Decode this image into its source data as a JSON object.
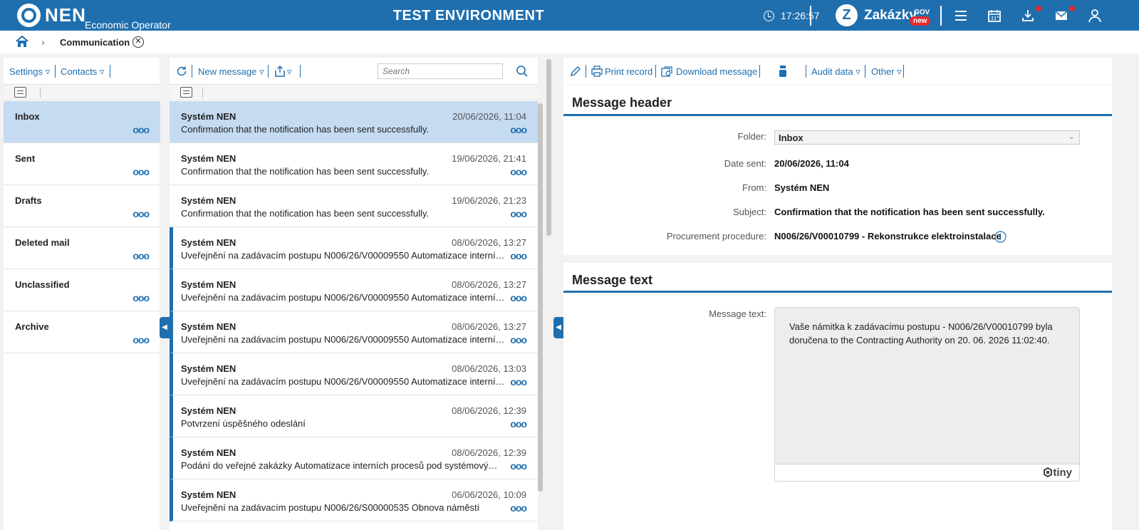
{
  "header": {
    "brand": "NEN",
    "brand_sub": "Economic Operator",
    "environment": "TEST ENVIRONMENT",
    "clock": "17:26:57",
    "zakazky": "Zakázky",
    "zakazky_gov": "GOV",
    "zakazky_badge": "new",
    "icons": [
      "menu-icon",
      "calendar-icon",
      "download-icon",
      "mail-icon",
      "user-icon"
    ]
  },
  "breadcrumb": {
    "current": "Communication"
  },
  "folders_panel": {
    "toolbar": {
      "settings": "Settings ▿",
      "contacts": "Contacts ▿"
    },
    "folders": [
      {
        "label": "Inbox",
        "active": true
      },
      {
        "label": "Sent"
      },
      {
        "label": "Drafts"
      },
      {
        "label": "Deleted mail"
      },
      {
        "label": "Unclassified"
      },
      {
        "label": "Archive"
      }
    ],
    "more": "ooo"
  },
  "messages_panel": {
    "toolbar": {
      "new_message": "New message ▿",
      "export_arrow": "▿",
      "search_placeholder": "Search"
    },
    "messages": [
      {
        "from": "Systém NEN",
        "date": "20/06/2026, 11:04",
        "subject": "Confirmation that the notification has been sent successfully."
      },
      {
        "from": "Systém NEN",
        "date": "19/06/2026, 21:41",
        "subject": "Confirmation that the notification has been sent successfully."
      },
      {
        "from": "Systém NEN",
        "date": "19/06/2026, 21:23",
        "subject": "Confirmation that the notification has been sent successfully."
      },
      {
        "from": "Systém NEN",
        "date": "08/06/2026, 13:27",
        "subject": "Uveřejnění na zadávacím postupu N006/26/V00009550 Automatizace interních procesů"
      },
      {
        "from": "Systém NEN",
        "date": "08/06/2026, 13:27",
        "subject": "Uveřejnění na zadávacím postupu N006/26/V00009550 Automatizace interních procesů"
      },
      {
        "from": "Systém NEN",
        "date": "08/06/2026, 13:27",
        "subject": "Uveřejnění na zadávacím postupu N006/26/V00009550 Automatizace interních procesů"
      },
      {
        "from": "Systém NEN",
        "date": "08/06/2026, 13:03",
        "subject": "Uveřejnění na zadávacím postupu N006/26/V00009550 Automatizace interních procesů"
      },
      {
        "from": "Systém NEN",
        "date": "08/06/2026, 12:39",
        "subject": "Potvrzení úspěšného odeslání"
      },
      {
        "from": "Systém NEN",
        "date": "08/06/2026, 12:39",
        "subject": "Podání do veřejné zakázky Automatizace interních procesů pod systémovým číslem"
      },
      {
        "from": "Systém NEN",
        "date": "06/06/2026, 10:09",
        "subject": "Uveřejnění na zadávacím postupu N006/26/S00000535 Obnova náměstí"
      }
    ]
  },
  "detail_panel": {
    "toolbar": {
      "print": "Print record",
      "download": "Download message",
      "audit": "Audit data ▿",
      "other": "Other ▿"
    },
    "header_section": {
      "title": "Message header",
      "folder_label": "Folder:",
      "folder_value": "Inbox",
      "date_label": "Date sent:",
      "date_value": "20/06/2026, 11:04",
      "from_label": "From:",
      "from_value": "Systém NEN",
      "subject_label": "Subject:",
      "subject_value": "Confirmation that the notification has been sent successfully.",
      "procurement_label": "Procurement procedure:",
      "procurement_value": "N006/26/V00010799 - Rekonstrukce elektroinstalace"
    },
    "text_section": {
      "title": "Message text",
      "label": "Message text:",
      "body": "Vaše námitka k zadávacímu postupu - N006/26/V00010799 byla doručena to the Contracting Authority on 20. 06. 2026 11:02:40.",
      "editor_brand": "tiny"
    }
  },
  "colors": {
    "primary": "#1f6faf",
    "selected": "#c5dbf2",
    "badge": "#e52b2b"
  }
}
